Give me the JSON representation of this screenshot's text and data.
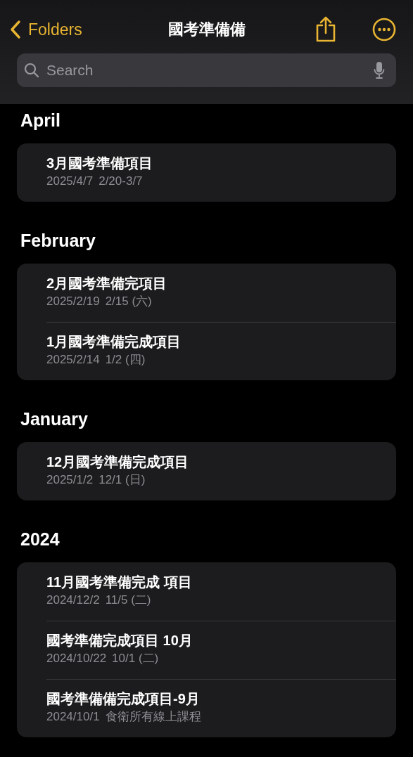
{
  "nav": {
    "back_label": "Folders",
    "title": "國考準備備"
  },
  "search": {
    "placeholder": "Search"
  },
  "sections": [
    {
      "heading": "April",
      "notes": [
        {
          "title": "3月國考準備項目",
          "date": "2025/4/7",
          "preview": "2/20-3/7"
        }
      ]
    },
    {
      "heading": "February",
      "notes": [
        {
          "title": "2月國考準備完項目",
          "date": "2025/2/19",
          "preview": "2/15 (六)"
        },
        {
          "title": "1月國考準備完成項目",
          "date": "2025/2/14",
          "preview": "1/2 (四)"
        }
      ]
    },
    {
      "heading": "January",
      "notes": [
        {
          "title": "12月國考準備完成項目",
          "date": "2025/1/2",
          "preview": "12/1 (日)"
        }
      ]
    },
    {
      "heading": "2024",
      "notes": [
        {
          "title": "11月國考準備完成 項目",
          "date": "2024/12/2",
          "preview": "11/5 (二)"
        },
        {
          "title": "國考準備完成項目 10月",
          "date": "2024/10/22",
          "preview": "10/1 (二)"
        },
        {
          "title": "國考準備備完成項目-9月",
          "date": "2024/10/1",
          "preview": "食衛所有線上課程"
        }
      ]
    }
  ]
}
